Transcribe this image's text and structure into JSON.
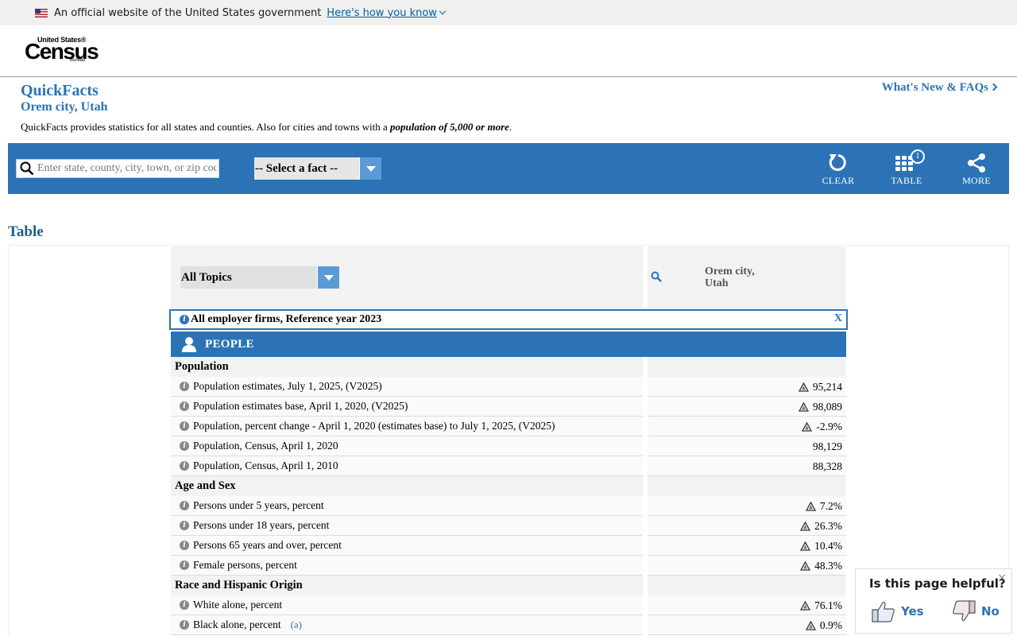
{
  "gov_banner": {
    "text": "An official website of the United States government",
    "link": "Here's how you know"
  },
  "logo": {
    "line1": "United States®",
    "line2": "Census",
    "line3": "Bureau"
  },
  "header": {
    "title": "QuickFacts",
    "place": "Orem city, Utah",
    "whats_new": "What's New & FAQs",
    "desc_prefix": "QuickFacts provides statistics for all states and counties. Also for cities and towns with a ",
    "desc_emphasis": "population of 5,000 or more",
    "desc_suffix": "."
  },
  "toolbar": {
    "search_placeholder": "Enter state, county, city, town, or zip code",
    "fact_select": "-- Select a fact --",
    "clear": "CLEAR",
    "table": "TABLE",
    "table_badge": "1",
    "more": "MORE"
  },
  "table": {
    "heading": "Table",
    "topics_select": "All Topics",
    "column_name": "Orem city,\nUtah",
    "selected_fact": "All employer firms, Reference year 2023",
    "selected_close": "X",
    "section_main": "PEOPLE",
    "groups": [
      {
        "title": "Population",
        "rows": [
          {
            "label": "Population estimates, July 1, 2025, (V2025)",
            "value": "95,214",
            "warn": true
          },
          {
            "label": "Population estimates base, April 1, 2020, (V2025)",
            "value": "98,089",
            "warn": true
          },
          {
            "label": "Population, percent change - April 1, 2020 (estimates base) to July 1, 2025, (V2025)",
            "value": "-2.9%",
            "warn": true
          },
          {
            "label": "Population, Census, April 1, 2020",
            "value": "98,129",
            "warn": false
          },
          {
            "label": "Population, Census, April 1, 2010",
            "value": "88,328",
            "warn": false
          }
        ]
      },
      {
        "title": "Age and Sex",
        "rows": [
          {
            "label": "Persons under 5 years, percent",
            "value": "7.2%",
            "warn": true
          },
          {
            "label": "Persons under 18 years, percent",
            "value": "26.3%",
            "warn": true
          },
          {
            "label": "Persons 65 years and over, percent",
            "value": "10.4%",
            "warn": true
          },
          {
            "label": "Female persons, percent",
            "value": "48.3%",
            "warn": true
          }
        ]
      },
      {
        "title": "Race and Hispanic Origin",
        "rows": [
          {
            "label": "White alone, percent",
            "value": "76.1%",
            "warn": true
          },
          {
            "label": "Black alone, percent",
            "footnote": "(a)",
            "value": "0.9%",
            "warn": true
          }
        ]
      }
    ]
  },
  "feedback": {
    "question": "Is this page helpful?",
    "yes": "Yes",
    "no": "No",
    "close": "×"
  },
  "colors": {
    "primary": "#2b73b6",
    "dropdown": "#5b9bd5",
    "banner_bg": "#f0f0f0"
  }
}
